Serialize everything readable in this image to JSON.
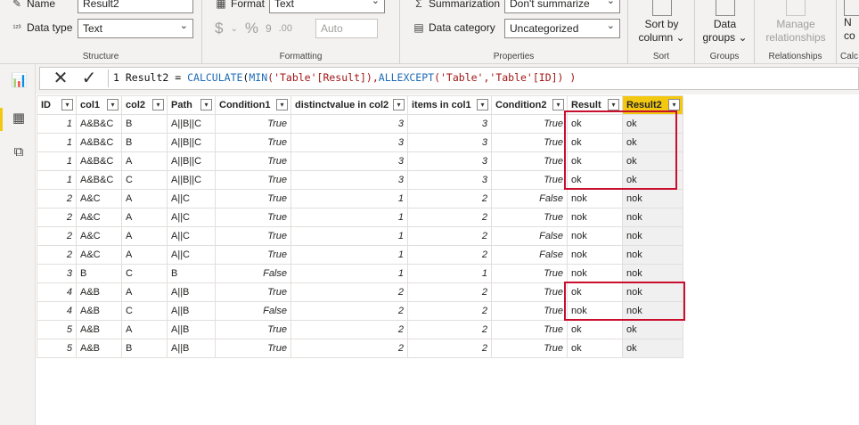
{
  "ribbon": {
    "structure": {
      "name_label": "Name",
      "name_value": "Result2",
      "datatype_label": "Data type",
      "datatype_value": "Text",
      "group_label": "Structure"
    },
    "formatting": {
      "format_label": "Format",
      "format_value": "Text",
      "currency_symbol": "$",
      "percent_symbol": "%",
      "comma_symbol": "9",
      "decimal_symbol": ".00",
      "auto_value": "Auto",
      "group_label": "Formatting"
    },
    "properties": {
      "summarization_label": "Summarization",
      "summarization_value": "Don't summarize",
      "datacategory_label": "Data category",
      "datacategory_value": "Uncategorized",
      "group_label": "Properties"
    },
    "sort": {
      "sort_by_column_label_1": "Sort by",
      "sort_by_column_label_2": "column",
      "group_label": "Sort"
    },
    "groups": {
      "data_groups_label_1": "Data",
      "data_groups_label_2": "groups",
      "group_label": "Groups"
    },
    "relationships": {
      "manage_label_1": "Manage",
      "manage_label_2": "relationships",
      "group_label": "Relationships"
    },
    "calc": {
      "new_label_1": "N",
      "new_label_2": "co",
      "group_label": "Calc"
    }
  },
  "formula": {
    "line_no": "1",
    "text_prefix": " Result2 = ",
    "fn1": "CALCULATE",
    "p1": "(",
    "fn2": "MIN",
    "arg1": "('Table'[Result]),",
    "fn3": "ALLEXCEPT",
    "arg2": "('Table','Table'[ID]) )"
  },
  "table": {
    "headers": [
      "ID",
      "col1",
      "col2",
      "Path",
      "Condition1",
      "distinctvalue in col2",
      "items in col1",
      "Condition2",
      "Result",
      "Result2"
    ],
    "rows": [
      [
        "1",
        "A&B&C",
        "B",
        "A||B||C",
        "True",
        "3",
        "3",
        "True",
        "ok",
        "ok"
      ],
      [
        "1",
        "A&B&C",
        "B",
        "A||B||C",
        "True",
        "3",
        "3",
        "True",
        "ok",
        "ok"
      ],
      [
        "1",
        "A&B&C",
        "A",
        "A||B||C",
        "True",
        "3",
        "3",
        "True",
        "ok",
        "ok"
      ],
      [
        "1",
        "A&B&C",
        "C",
        "A||B||C",
        "True",
        "3",
        "3",
        "True",
        "ok",
        "ok"
      ],
      [
        "2",
        "A&C",
        "A",
        "A||C",
        "True",
        "1",
        "2",
        "False",
        "nok",
        "nok"
      ],
      [
        "2",
        "A&C",
        "A",
        "A||C",
        "True",
        "1",
        "2",
        "True",
        "nok",
        "nok"
      ],
      [
        "2",
        "A&C",
        "A",
        "A||C",
        "True",
        "1",
        "2",
        "False",
        "nok",
        "nok"
      ],
      [
        "2",
        "A&C",
        "A",
        "A||C",
        "True",
        "1",
        "2",
        "False",
        "nok",
        "nok"
      ],
      [
        "3",
        "B",
        "C",
        "B",
        "False",
        "1",
        "1",
        "True",
        "nok",
        "nok"
      ],
      [
        "4",
        "A&B",
        "A",
        "A||B",
        "True",
        "2",
        "2",
        "True",
        "ok",
        "nok"
      ],
      [
        "4",
        "A&B",
        "C",
        "A||B",
        "False",
        "2",
        "2",
        "True",
        "nok",
        "nok"
      ],
      [
        "5",
        "A&B",
        "A",
        "A||B",
        "True",
        "2",
        "2",
        "True",
        "ok",
        "ok"
      ],
      [
        "5",
        "A&B",
        "B",
        "A||B",
        "True",
        "2",
        "2",
        "True",
        "ok",
        "ok"
      ]
    ]
  },
  "colors": {
    "accent": "#f2c811",
    "highlight_box": "#c8102e"
  }
}
